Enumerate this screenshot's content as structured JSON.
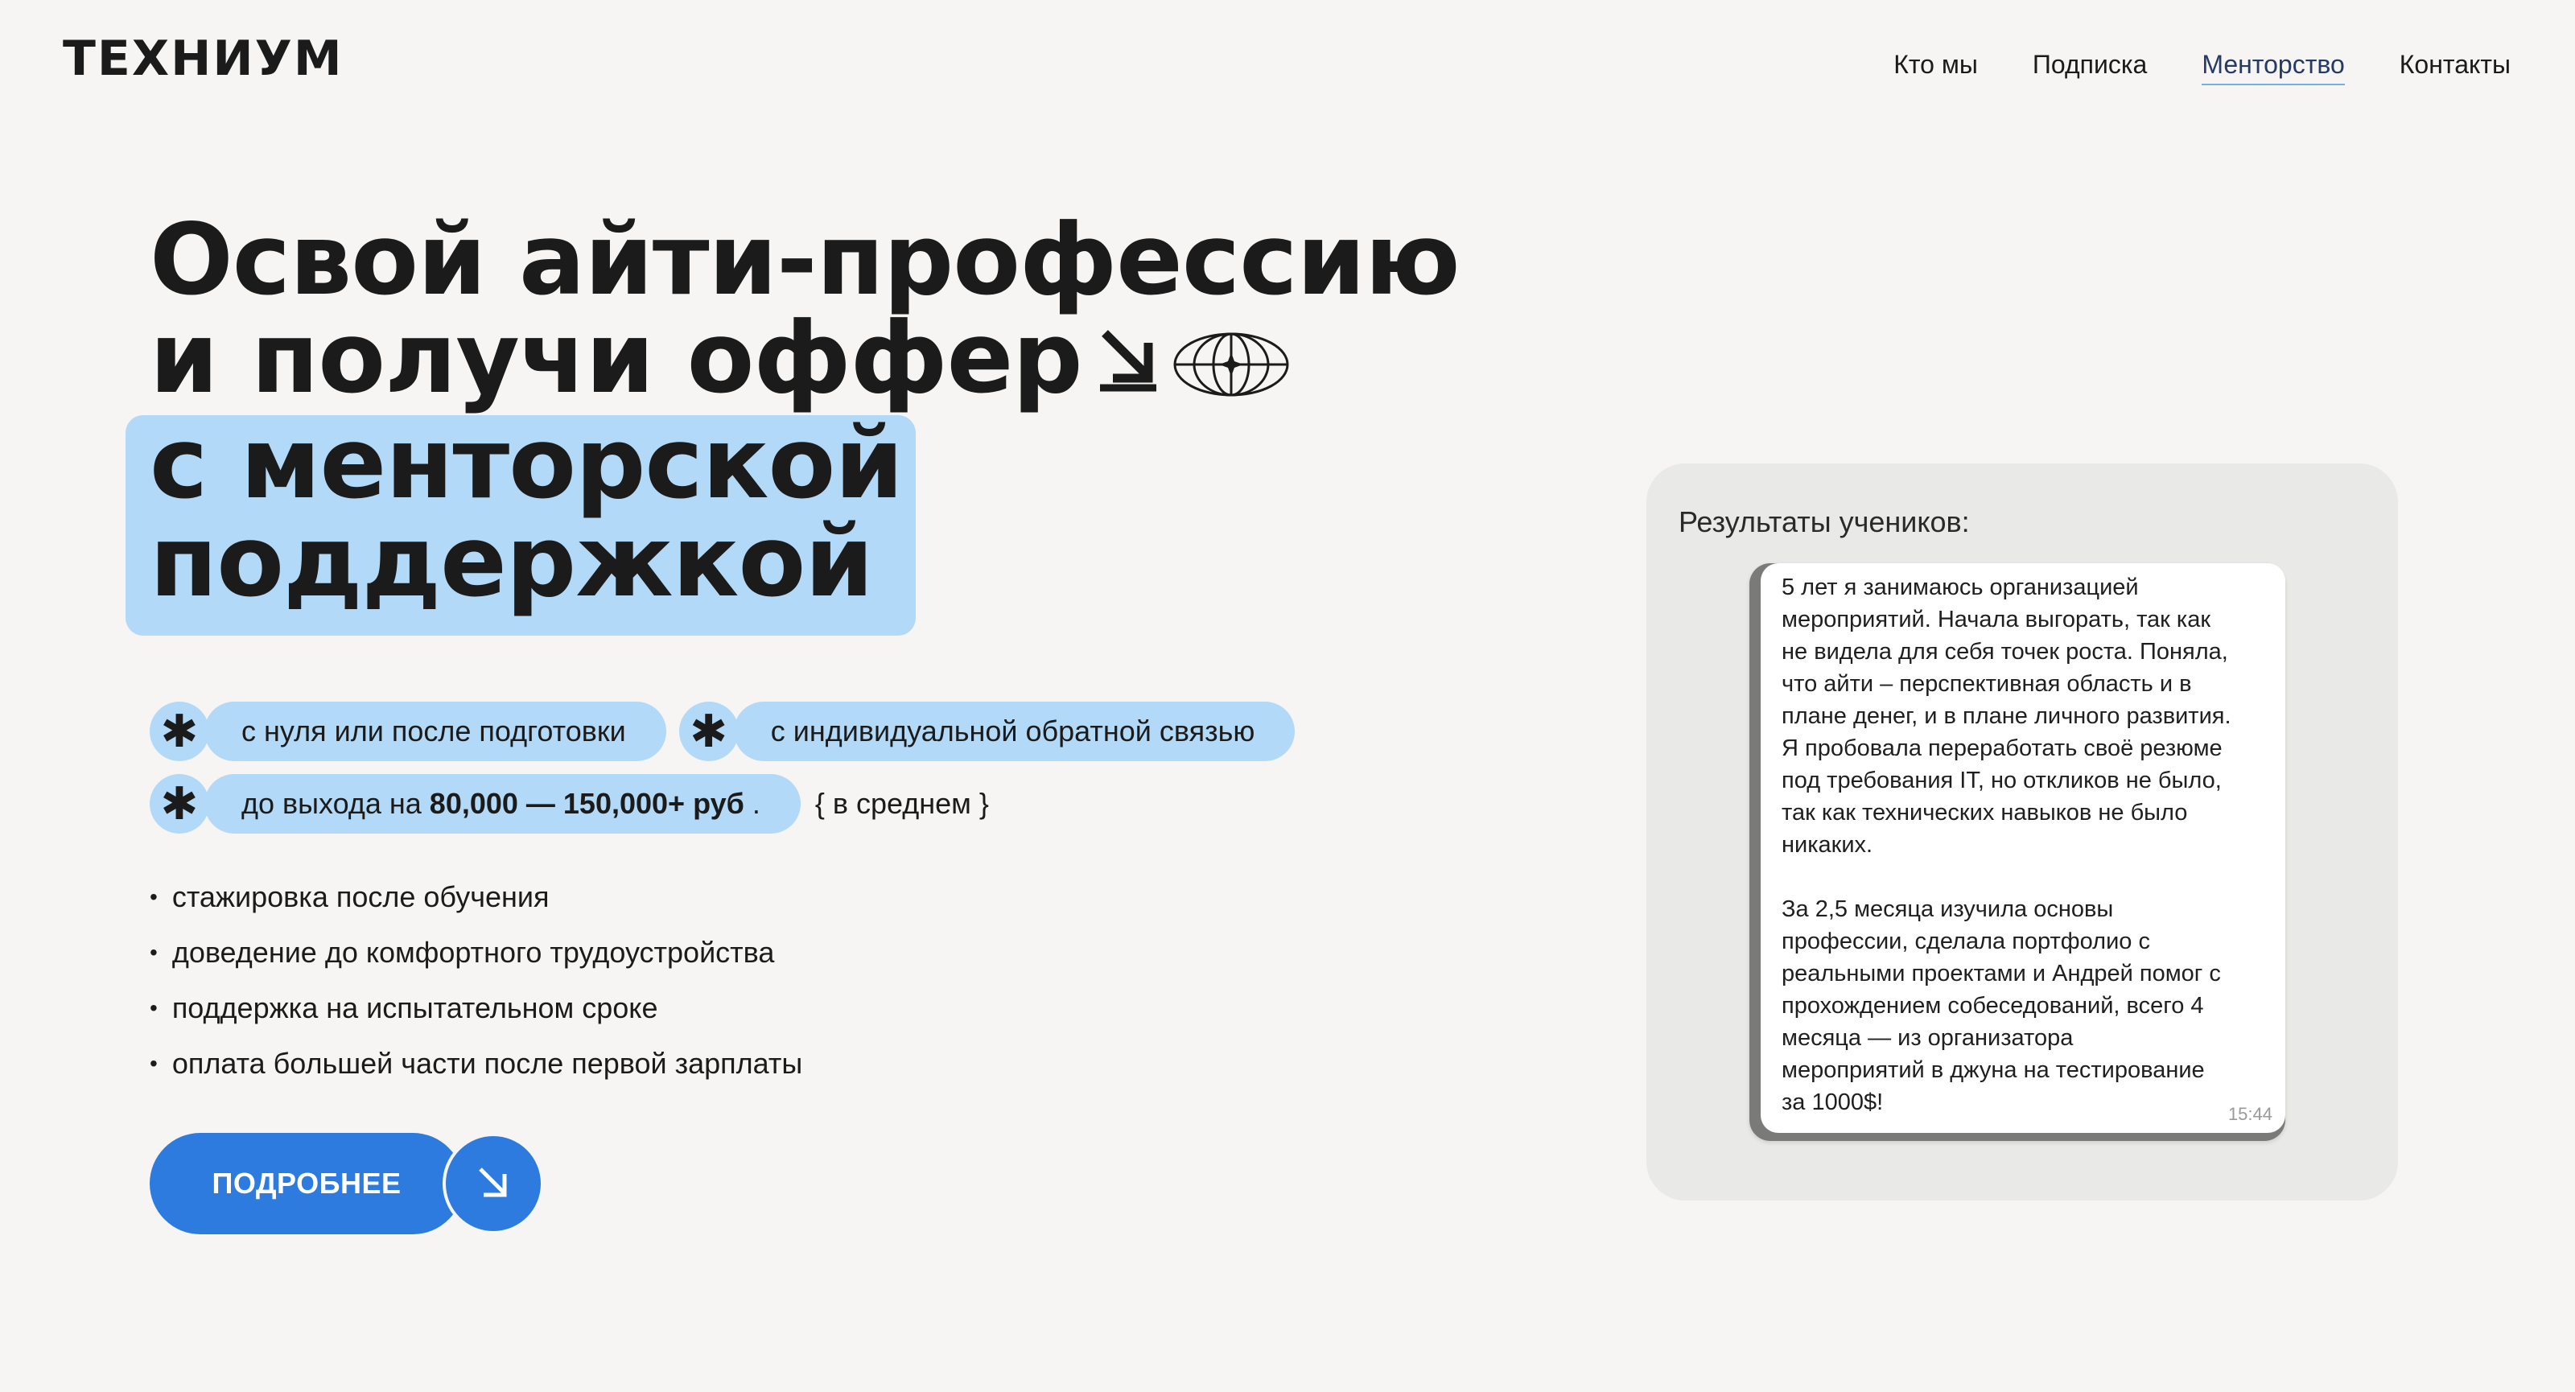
{
  "header": {
    "logo": "ТЕХНИУМ",
    "nav": [
      {
        "label": "Кто мы"
      },
      {
        "label": "Подписка"
      },
      {
        "label": "Менторство"
      },
      {
        "label": "Контакты"
      }
    ],
    "active_nav": "Менторство"
  },
  "hero": {
    "title_lines": [
      "Освой айти-профессию",
      "и получи оффер",
      "с менторской",
      "поддержкой"
    ]
  },
  "features": {
    "pill1": "с нуля или после подготовки",
    "pill2": "с индивидуальной обратной связью",
    "pill3_prefix": "до выхода на",
    "pill3_bold": "80,000 — 150,000+ руб",
    "pill3_suffix": ".",
    "note": "{ в среднем }"
  },
  "bullets": [
    "стажировка после обучения",
    "доведение до комфортного трудоустройства",
    "поддержка на испытательном сроке",
    "оплата большей части после первой зарплаты"
  ],
  "cta": {
    "label": "ПОДРОБНЕЕ"
  },
  "results": {
    "title": "Результаты учеников:",
    "review_text": "5 лет я занимаюсь организацией\nмероприятий. Начала выгорать, так как\nне видела для себя точек роста. Поняла,\nчто айти – перспективная область и в\nплане денег, и в плане личного развития.\nЯ пробовала переработать своё резюме\nпод требования IT, но откликов не было,\nтак как технических навыков не было\nникаких.\n\nЗа 2,5 месяца изучила основы\nпрофессии, сделала портфолио с\nреальными проектами и Андрей помог с\nпрохождением собеседований, всего 4\nмесяца — из организатора\nмероприятий в джуна на тестирование\nза 1000$!",
    "review_time": "15:44"
  },
  "colors": {
    "background": "#f6f5f3",
    "accent_light": "#b2d9f7",
    "accent_blue": "#2d7bde",
    "text": "#1b1b1b"
  },
  "icons": [
    "arrow-down-right-icon",
    "globe-icon",
    "asterisk-icon"
  ]
}
